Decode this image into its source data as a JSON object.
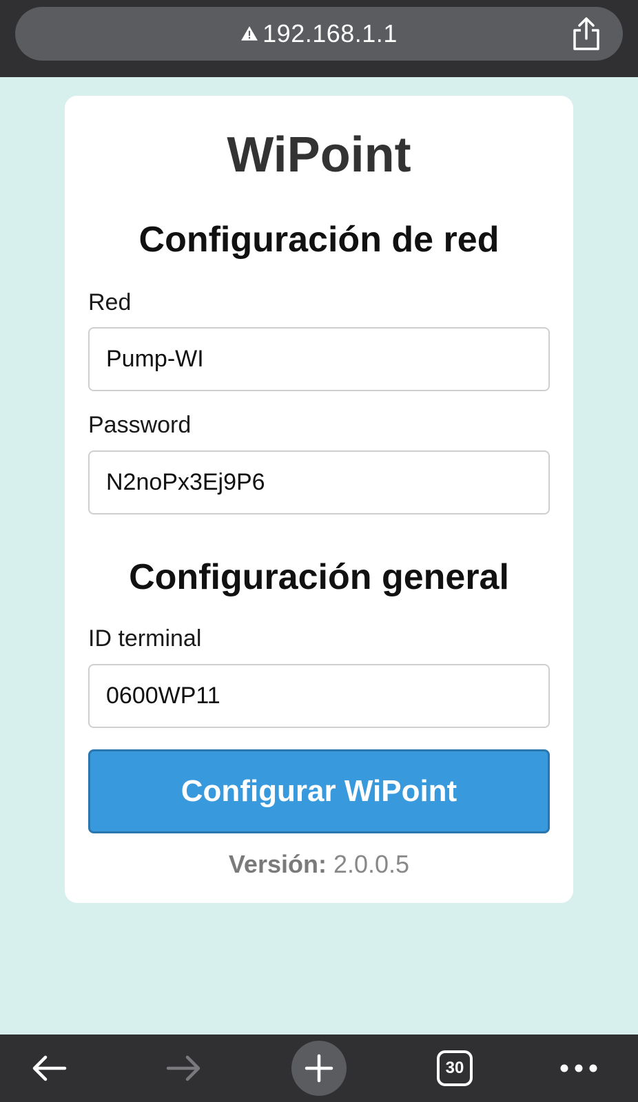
{
  "browser": {
    "url": "192.168.1.1",
    "security_icon": "warning-triangle-icon",
    "share_icon": "share-icon",
    "toolbar": {
      "back_icon": "arrow-left-icon",
      "forward_icon": "arrow-right-icon",
      "new_tab_icon": "plus-icon",
      "tab_count": "30",
      "more_icon": "ellipsis-icon"
    }
  },
  "page": {
    "title": "WiPoint",
    "network_section": {
      "heading": "Configuración de red",
      "network_label": "Red",
      "network_value": "Pump-WI",
      "password_label": "Password",
      "password_value": "N2noPx3Ej9P6"
    },
    "general_section": {
      "heading": "Configuración general",
      "terminal_label": "ID terminal",
      "terminal_value": "0600WP11"
    },
    "submit_label": "Configurar WiPoint",
    "version_label": "Versión:",
    "version_value": "2.0.0.5"
  },
  "colors": {
    "background": "#d7f0ed",
    "button": "#3899dc",
    "browser_chrome": "#303032"
  }
}
